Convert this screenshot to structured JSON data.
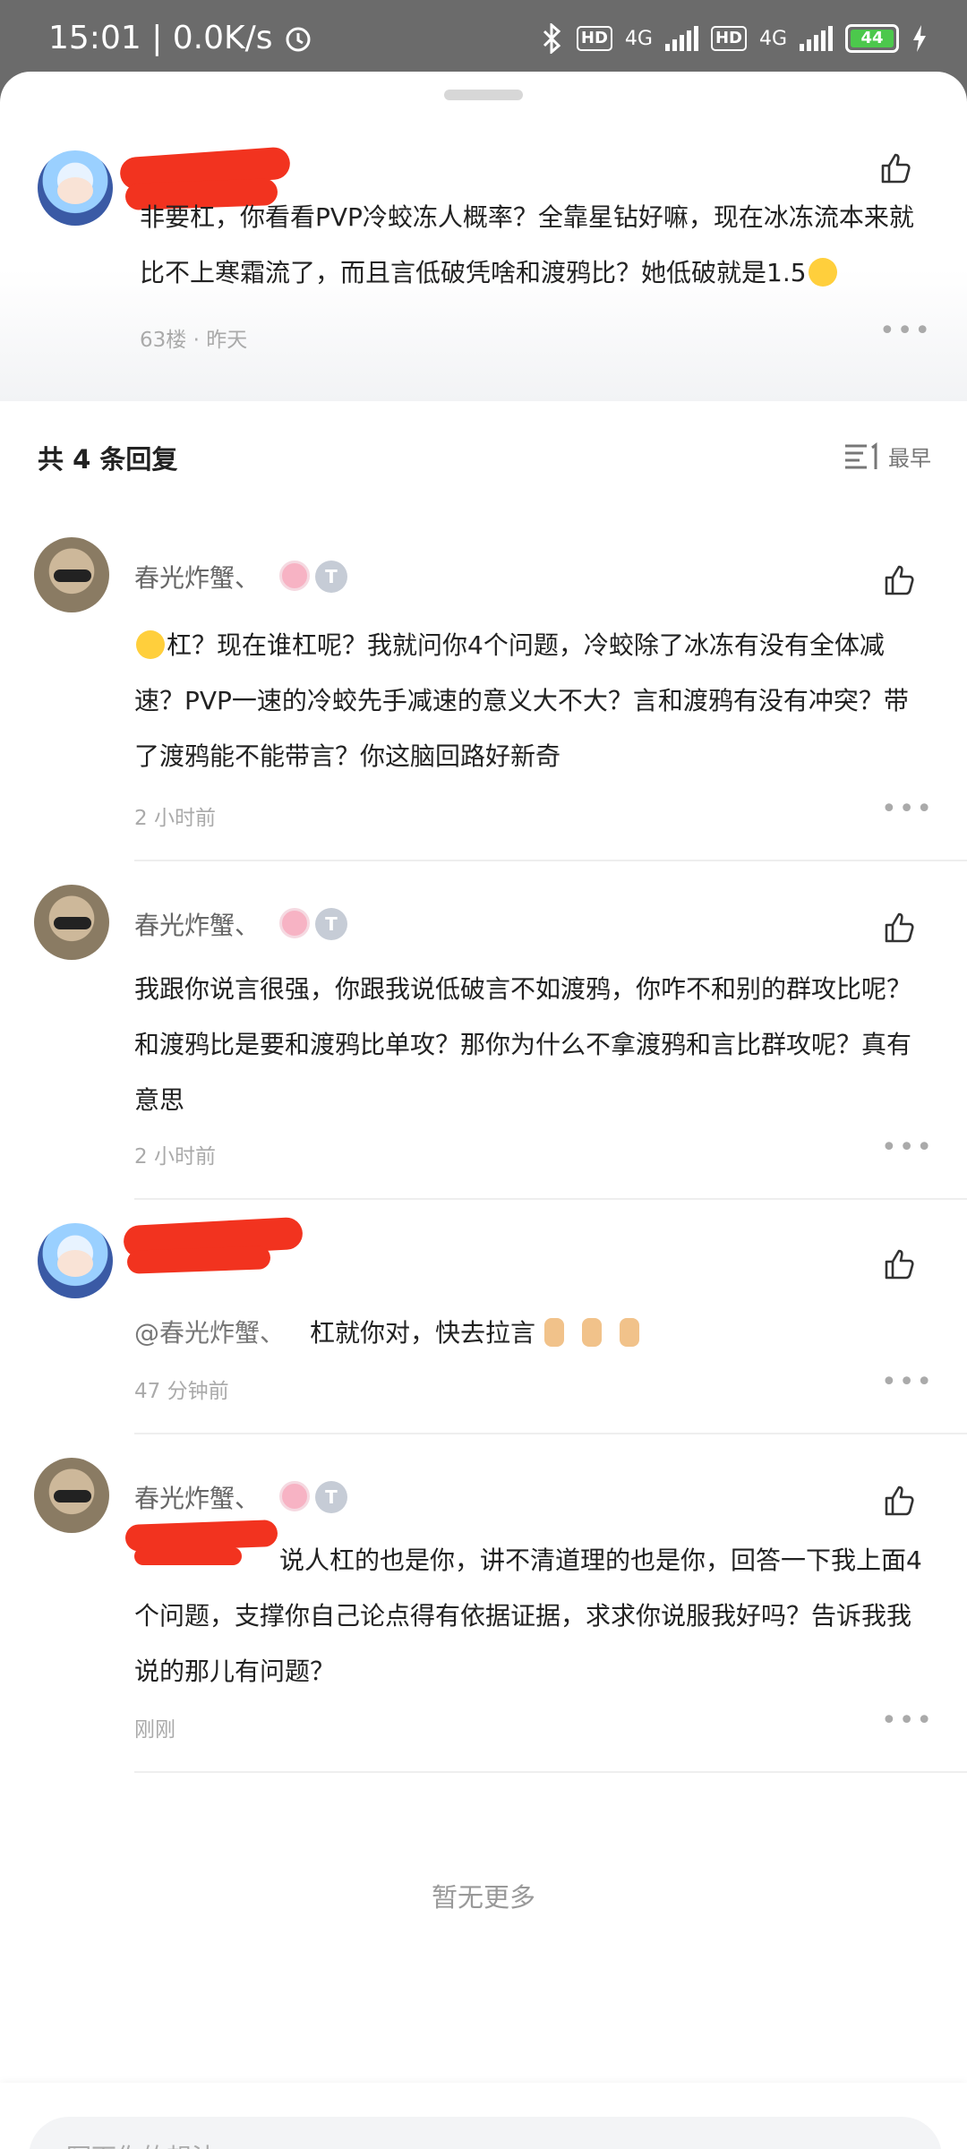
{
  "status_bar": {
    "time_speed": "15:01 | 0.0K/s",
    "net1": "4G",
    "net2": "4G",
    "hd": "HD",
    "battery": "44"
  },
  "main_comment": {
    "text": "非要杠，你看看PVP冷蛟冻人概率？全靠星钻好嘛，现在冰冻流本来就比不上寒霜流了，而且言低破凭啥和渡鸦比？她低破就是1.5",
    "meta": "63楼 · 昨天"
  },
  "replies_header": {
    "title": "共 4 条回复",
    "sort_label": "最早"
  },
  "replies": [
    {
      "name": "春光炸蟹、",
      "text": "杠？现在谁杠呢？我就问你4个问题，冷蛟除了冰冻有没有全体减速？PVP一速的冷蛟先手减速的意义大不大？言和渡鸦有没有冲突？带了渡鸦能不能带言？你这脑回路好新奇",
      "time": "2 小时前",
      "badge_t": "T"
    },
    {
      "name": "春光炸蟹、",
      "text": "我跟你说言很强，你跟我说低破言不如渡鸦，你咋不和别的群攻比呢？和渡鸦比是要和渡鸦比单攻？那你为什么不拿渡鸦和言比群攻呢？真有意思",
      "time": "2 小时前",
      "badge_t": "T"
    },
    {
      "mention": "@春光炸蟹、",
      "text": "杠就你对，快去拉言",
      "time": "47 分钟前"
    },
    {
      "name": "春光炸蟹、",
      "text": "说人杠的也是你，讲不清道理的也是你，回答一下我上面4个问题，支撑你自己论点得有依据证据，求求你说服我好吗？告诉我我说的那儿有问题？",
      "time": "刚刚",
      "badge_t": "T"
    }
  ],
  "end_text": "暂无更多",
  "input": {
    "placeholder": "写下你的想法..."
  }
}
